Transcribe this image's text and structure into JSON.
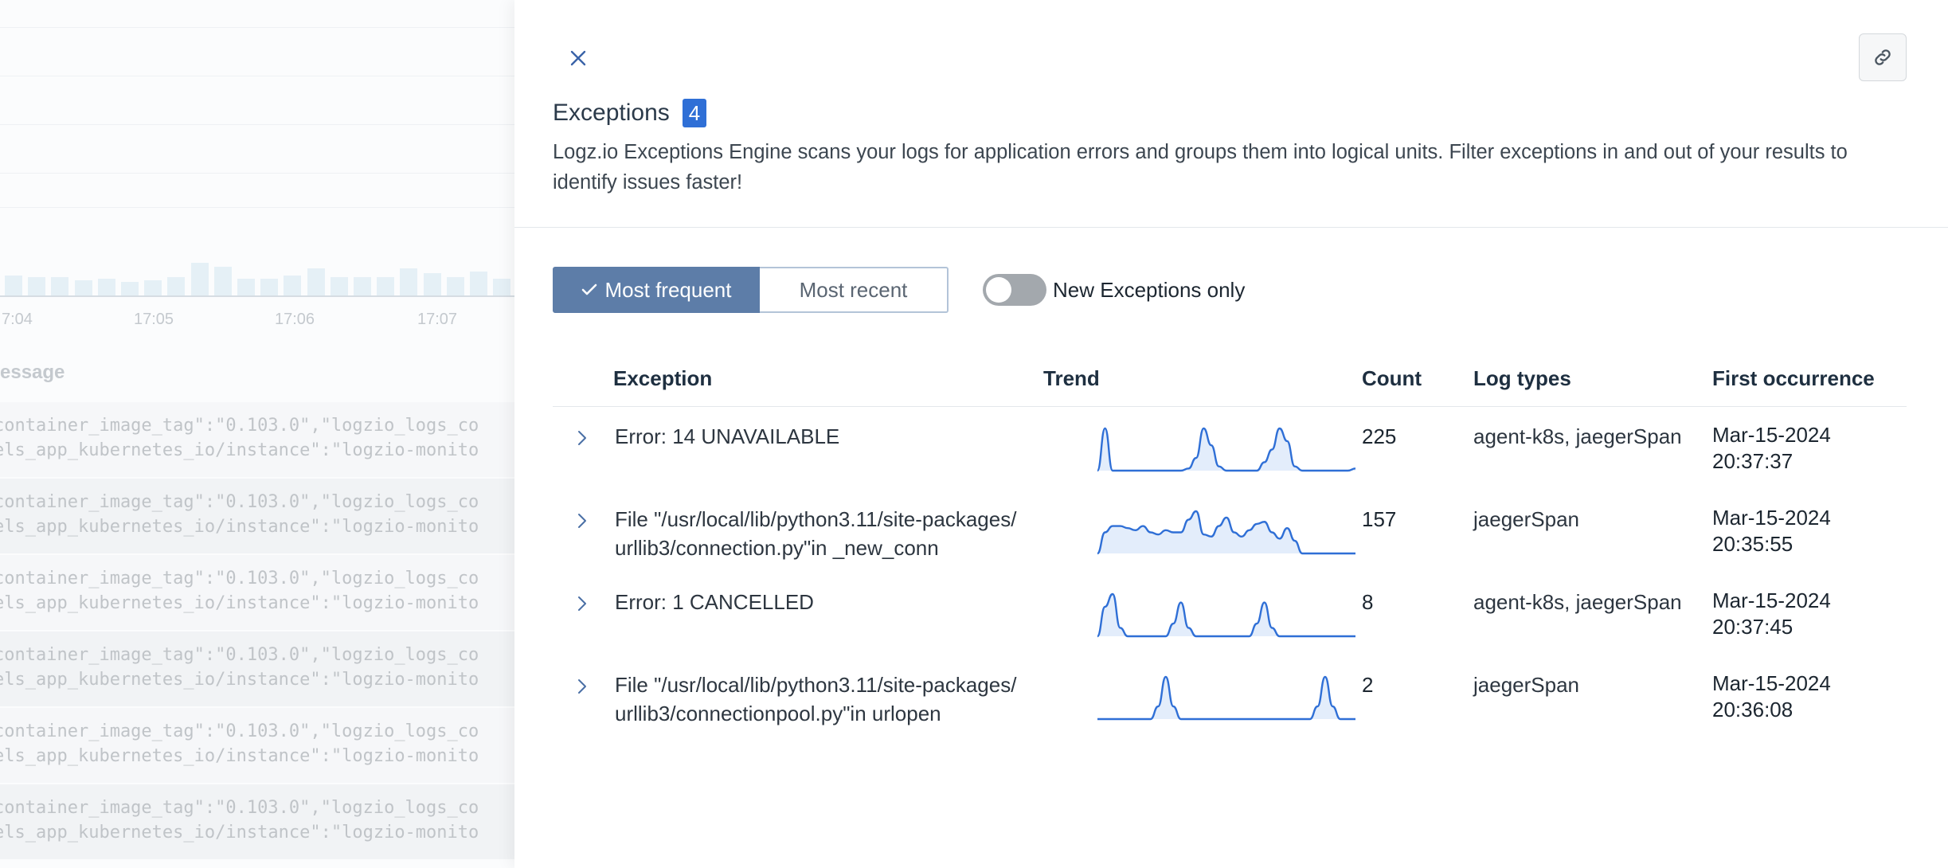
{
  "background": {
    "time_ticks": [
      "7:04",
      "17:05",
      "17:06",
      "17:07"
    ],
    "histogram_heights": [
      0.6,
      0.55,
      0.55,
      0.45,
      0.5,
      0.4,
      0.45,
      0.55,
      0.95,
      0.85,
      0.5,
      0.5,
      0.6,
      0.8,
      0.55,
      0.55,
      0.55,
      0.8,
      0.65,
      0.55,
      0.7,
      0.5
    ],
    "message_header": "essage",
    "log_rows": [
      {
        "line1": "container_image_tag\":\"0.103.0\",\"logzio_logs_co",
        "line2": "els_app_kubernetes_io/instance\":\"logzio-monito"
      },
      {
        "line1": "container_image_tag\":\"0.103.0\",\"logzio_logs_co",
        "line2": "els_app_kubernetes_io/instance\":\"logzio-monito"
      },
      {
        "line1": "container_image_tag\":\"0.103.0\",\"logzio_logs_co",
        "line2": "els_app_kubernetes_io/instance\":\"logzio-monito"
      },
      {
        "line1": "container_image_tag\":\"0.103.0\",\"logzio_logs_co",
        "line2": "els_app_kubernetes_io/instance\":\"logzio-monito"
      },
      {
        "line1": "container_image_tag\":\"0.103.0\",\"logzio_logs_co",
        "line2": "els_app_kubernetes_io/instance\":\"logzio-monito"
      },
      {
        "line1": "container_image_tag\":\"0.103.0\",\"logzio_logs_co",
        "line2": "els_app_kubernetes_io/instance\":\"logzio-monito"
      }
    ]
  },
  "panel": {
    "title": "Exceptions",
    "badge_count": "4",
    "description": "Logz.io Exceptions Engine scans your logs for application errors and groups them into logical units. Filter exceptions in and out of your results to identify issues faster!",
    "sort_options": {
      "most_frequent": "Most frequent",
      "most_recent": "Most recent"
    },
    "selected_sort": "most_frequent",
    "new_only_label": "New Exceptions only",
    "new_only_enabled": false,
    "columns": {
      "exception": "Exception",
      "trend": "Trend",
      "count": "Count",
      "log_types": "Log types",
      "first_occurrence": "First occurrence"
    },
    "rows": [
      {
        "exception": "Error: 14 UNAVAILABLE",
        "count": "225",
        "log_types": "agent-k8s, jaegerSpan",
        "first_date": "Mar-15-2024",
        "first_time": "20:37:37",
        "trend": [
          0,
          1,
          0,
          0,
          0,
          0,
          0,
          0,
          0,
          0,
          0,
          0,
          0.05,
          0.3,
          1,
          0.6,
          0.1,
          0,
          0,
          0,
          0,
          0,
          0.2,
          0.5,
          1,
          0.7,
          0.1,
          0,
          0,
          0,
          0,
          0,
          0,
          0,
          0.05
        ]
      },
      {
        "exception": "File \"/usr/local/lib/python3.11/site-packages/urllib3/connection.py\"in _new_conn",
        "count": "157",
        "log_types": "jaegerSpan",
        "first_date": "Mar-15-2024",
        "first_time": "20:35:55",
        "trend": [
          0,
          0.5,
          0.65,
          0.65,
          0.6,
          0.55,
          0.65,
          0.5,
          0.45,
          0.55,
          0.5,
          0.5,
          0.8,
          1,
          0.45,
          0.4,
          0.65,
          0.85,
          0.5,
          0.4,
          0.55,
          0.7,
          0.75,
          0.5,
          0.35,
          0.6,
          0.3,
          0,
          0,
          0,
          0,
          0,
          0,
          0,
          0
        ]
      },
      {
        "exception": "Error: 1 CANCELLED",
        "count": "8",
        "log_types": "agent-k8s, jaegerSpan",
        "first_date": "Mar-15-2024",
        "first_time": "20:37:45",
        "trend": [
          0,
          0.7,
          1,
          0.2,
          0,
          0,
          0,
          0,
          0,
          0,
          0.3,
          0.8,
          0.2,
          0,
          0,
          0,
          0,
          0,
          0,
          0,
          0,
          0.3,
          0.8,
          0.2,
          0,
          0,
          0,
          0,
          0,
          0,
          0,
          0,
          0,
          0,
          0
        ]
      },
      {
        "exception": "File \"/usr/local/lib/python3.11/site-packages/urllib3/connectionpool.py\"in urlopen",
        "count": "2",
        "log_types": "jaegerSpan",
        "first_date": "Mar-15-2024",
        "first_time": "20:36:08",
        "trend": [
          0,
          0,
          0,
          0,
          0,
          0,
          0,
          0,
          0.3,
          1,
          0.3,
          0,
          0,
          0,
          0,
          0,
          0,
          0,
          0,
          0,
          0,
          0,
          0,
          0,
          0,
          0,
          0,
          0,
          0,
          0.3,
          1,
          0.3,
          0,
          0,
          0
        ]
      }
    ]
  },
  "colors": {
    "accent_badge": "#2f6fd6",
    "sort_active_bg": "#5d7da8",
    "trend_line": "#2f6fd6",
    "trend_fill": "#e3edfb"
  }
}
